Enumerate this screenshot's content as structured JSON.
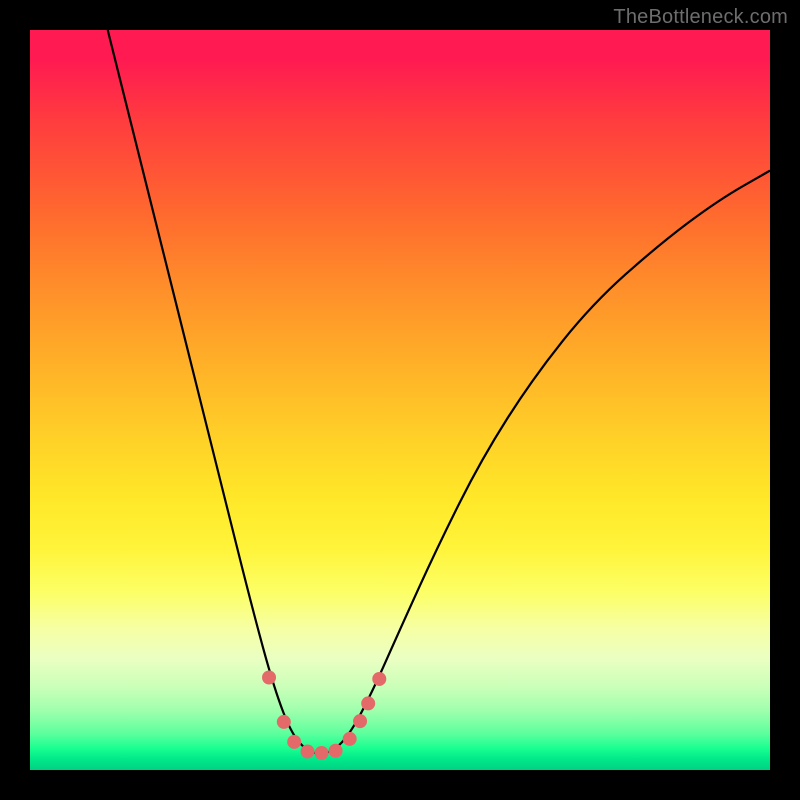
{
  "watermark": "TheBottleneck.com",
  "chart_data": {
    "type": "line",
    "title": "",
    "xlabel": "",
    "ylabel": "",
    "xlim": [
      0,
      100
    ],
    "ylim": [
      0,
      100
    ],
    "background_gradient": {
      "top": "#ff1a52",
      "mid_upper": "#ff8f2a",
      "mid": "#ffe728",
      "mid_lower": "#f6ffa5",
      "bottom": "#00d184"
    },
    "series": [
      {
        "name": "bottleneck-curve",
        "stroke": "#000000",
        "points": [
          {
            "x": 10.5,
            "y": 100
          },
          {
            "x": 14,
            "y": 86
          },
          {
            "x": 18,
            "y": 70
          },
          {
            "x": 22,
            "y": 54
          },
          {
            "x": 26,
            "y": 38
          },
          {
            "x": 30,
            "y": 22
          },
          {
            "x": 33,
            "y": 11
          },
          {
            "x": 35.5,
            "y": 4.5
          },
          {
            "x": 38,
            "y": 2.2
          },
          {
            "x": 40.5,
            "y": 2.2
          },
          {
            "x": 43,
            "y": 4.5
          },
          {
            "x": 46,
            "y": 10
          },
          {
            "x": 50,
            "y": 19
          },
          {
            "x": 55,
            "y": 30
          },
          {
            "x": 61,
            "y": 42
          },
          {
            "x": 68,
            "y": 53
          },
          {
            "x": 76,
            "y": 63
          },
          {
            "x": 85,
            "y": 71
          },
          {
            "x": 93,
            "y": 77
          },
          {
            "x": 100,
            "y": 81
          }
        ]
      }
    ],
    "markers": {
      "color": "#e46a6a",
      "radius_px": 7,
      "points": [
        {
          "x": 32.3,
          "y": 12.5
        },
        {
          "x": 34.3,
          "y": 6.5
        },
        {
          "x": 35.7,
          "y": 3.8
        },
        {
          "x": 37.5,
          "y": 2.5
        },
        {
          "x": 39.4,
          "y": 2.3
        },
        {
          "x": 41.3,
          "y": 2.6
        },
        {
          "x": 43.2,
          "y": 4.2
        },
        {
          "x": 44.6,
          "y": 6.6
        },
        {
          "x": 45.7,
          "y": 9.0
        },
        {
          "x": 47.2,
          "y": 12.3
        }
      ]
    }
  }
}
